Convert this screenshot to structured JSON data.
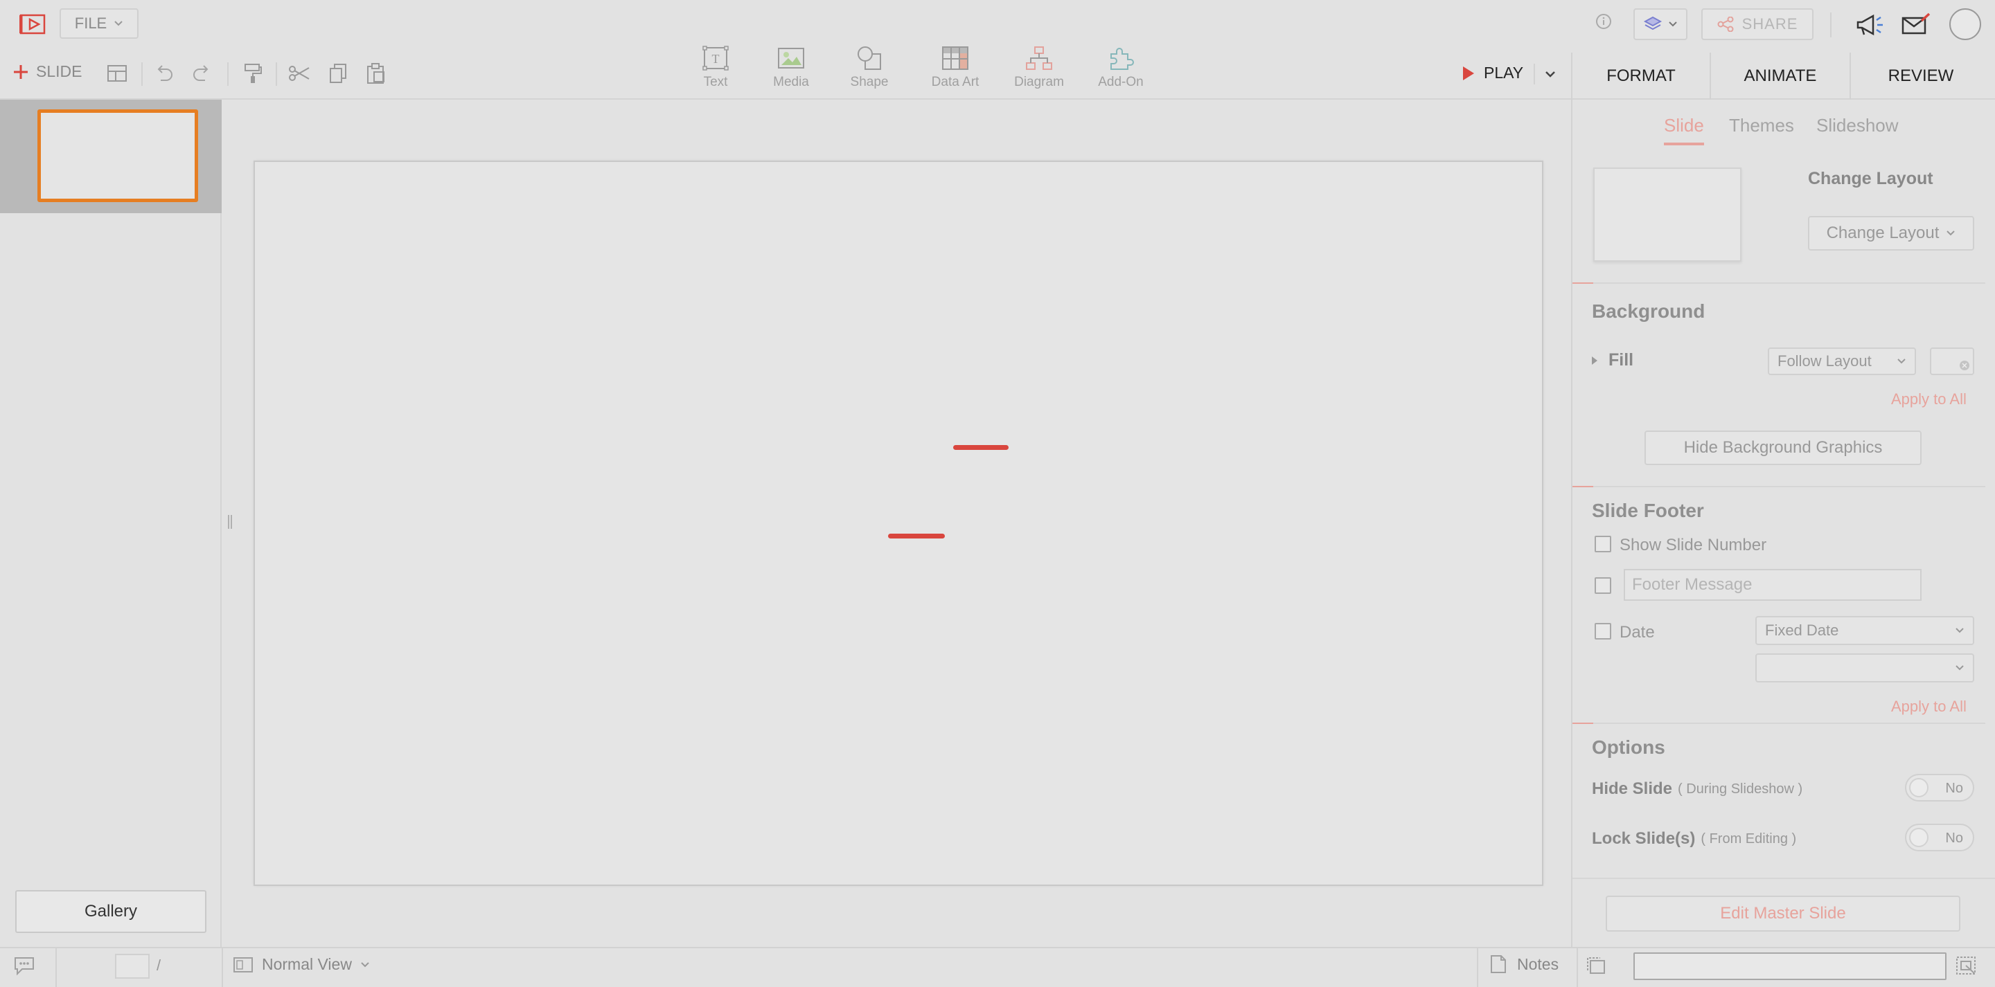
{
  "topbar": {
    "file_label": "FILE",
    "share_label": "SHARE"
  },
  "toolbar": {
    "slide_label": "SLIDE",
    "insert_items": [
      {
        "label": "Text",
        "icon": "text-icon"
      },
      {
        "label": "Media",
        "icon": "media-icon"
      },
      {
        "label": "Shape",
        "icon": "shape-icon"
      },
      {
        "label": "Data Art",
        "icon": "data-art-icon"
      },
      {
        "label": "Diagram",
        "icon": "diagram-icon"
      },
      {
        "label": "Add-On",
        "icon": "add-on-icon"
      }
    ],
    "play_label": "PLAY"
  },
  "panel": {
    "tabs": [
      "FORMAT",
      "ANIMATE",
      "REVIEW"
    ],
    "subtabs": [
      "Slide",
      "Themes",
      "Slideshow"
    ],
    "change_layout_heading": "Change Layout",
    "change_layout_button": "Change Layout",
    "background": {
      "heading": "Background",
      "fill_label": "Fill",
      "fill_value": "Follow Layout",
      "apply_all": "Apply to All",
      "hide_bg_button": "Hide Background Graphics"
    },
    "footer": {
      "heading": "Slide Footer",
      "show_slide_number": "Show Slide Number",
      "footer_placeholder": "Footer Message",
      "date_label": "Date",
      "date_value": "Fixed Date",
      "apply_all": "Apply to All"
    },
    "options": {
      "heading": "Options",
      "hide_slide_label": "Hide Slide",
      "hide_slide_note": "( During Slideshow )",
      "hide_slide_value": "No",
      "lock_slide_label": "Lock Slide(s)",
      "lock_slide_note": "( From Editing )",
      "lock_slide_value": "No"
    },
    "edit_master": "Edit Master Slide"
  },
  "sidebar": {
    "gallery_label": "Gallery"
  },
  "statusbar": {
    "page_separator": "/",
    "view_label": "Normal View",
    "notes_label": "Notes"
  },
  "colors": {
    "accent": "#d9463e",
    "thumb_border": "#e67e22",
    "background": "#e2e2e2"
  }
}
